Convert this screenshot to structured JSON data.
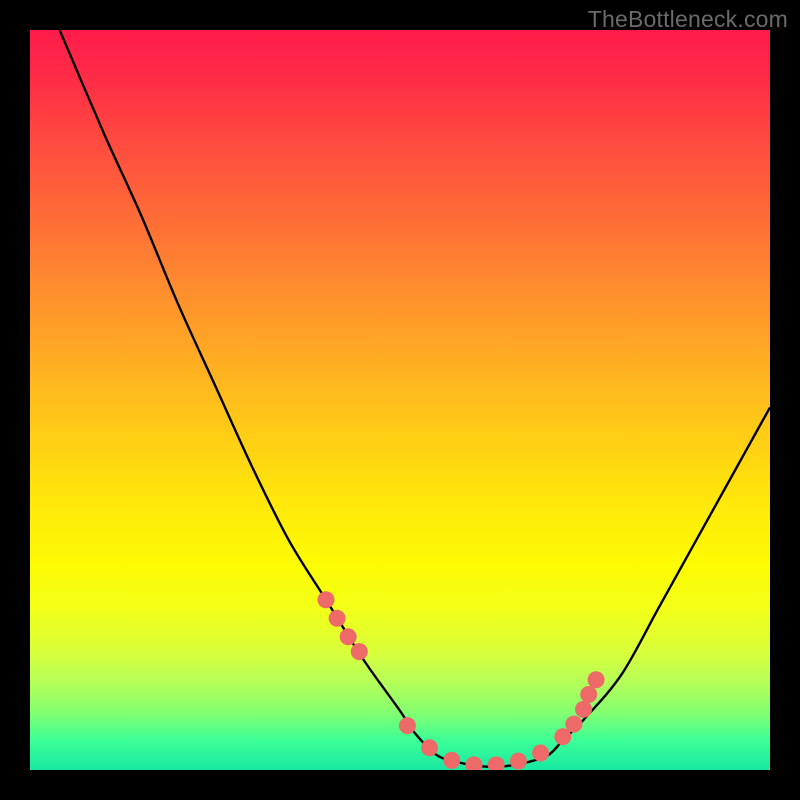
{
  "watermark": "TheBottleneck.com",
  "chart_data": {
    "type": "line",
    "title": "",
    "xlabel": "",
    "ylabel": "",
    "xlim": [
      0,
      100
    ],
    "ylim": [
      0,
      100
    ],
    "series": [
      {
        "name": "bottleneck-curve",
        "x": [
          4,
          10,
          15,
          20,
          25,
          30,
          35,
          40,
          45,
          50,
          52,
          55,
          58,
          61,
          64,
          67,
          70,
          72,
          75,
          80,
          85,
          90,
          95,
          100
        ],
        "y": [
          100,
          86,
          75,
          63,
          52,
          41,
          31,
          23,
          15,
          8,
          5,
          2,
          1,
          0.5,
          0.5,
          1,
          2,
          4,
          7,
          13,
          22,
          31,
          40,
          49
        ]
      }
    ],
    "markers": {
      "name": "highlight-dots",
      "x": [
        40,
        41.5,
        43,
        44.5,
        51,
        54,
        57,
        60,
        63,
        66,
        69,
        72,
        73.5,
        74.8,
        75.5,
        76.5
      ],
      "y": [
        23,
        20.5,
        18,
        16,
        6,
        3,
        1.3,
        0.7,
        0.7,
        1.2,
        2.3,
        4.5,
        6.2,
        8.2,
        10.2,
        12.2
      ]
    },
    "background": {
      "type": "vertical-gradient",
      "stops": [
        {
          "pos": 0,
          "color": "#ff1c4b"
        },
        {
          "pos": 50,
          "color": "#ffcb16"
        },
        {
          "pos": 78,
          "color": "#f3ff17"
        },
        {
          "pos": 100,
          "color": "#18e8a3"
        }
      ]
    }
  }
}
